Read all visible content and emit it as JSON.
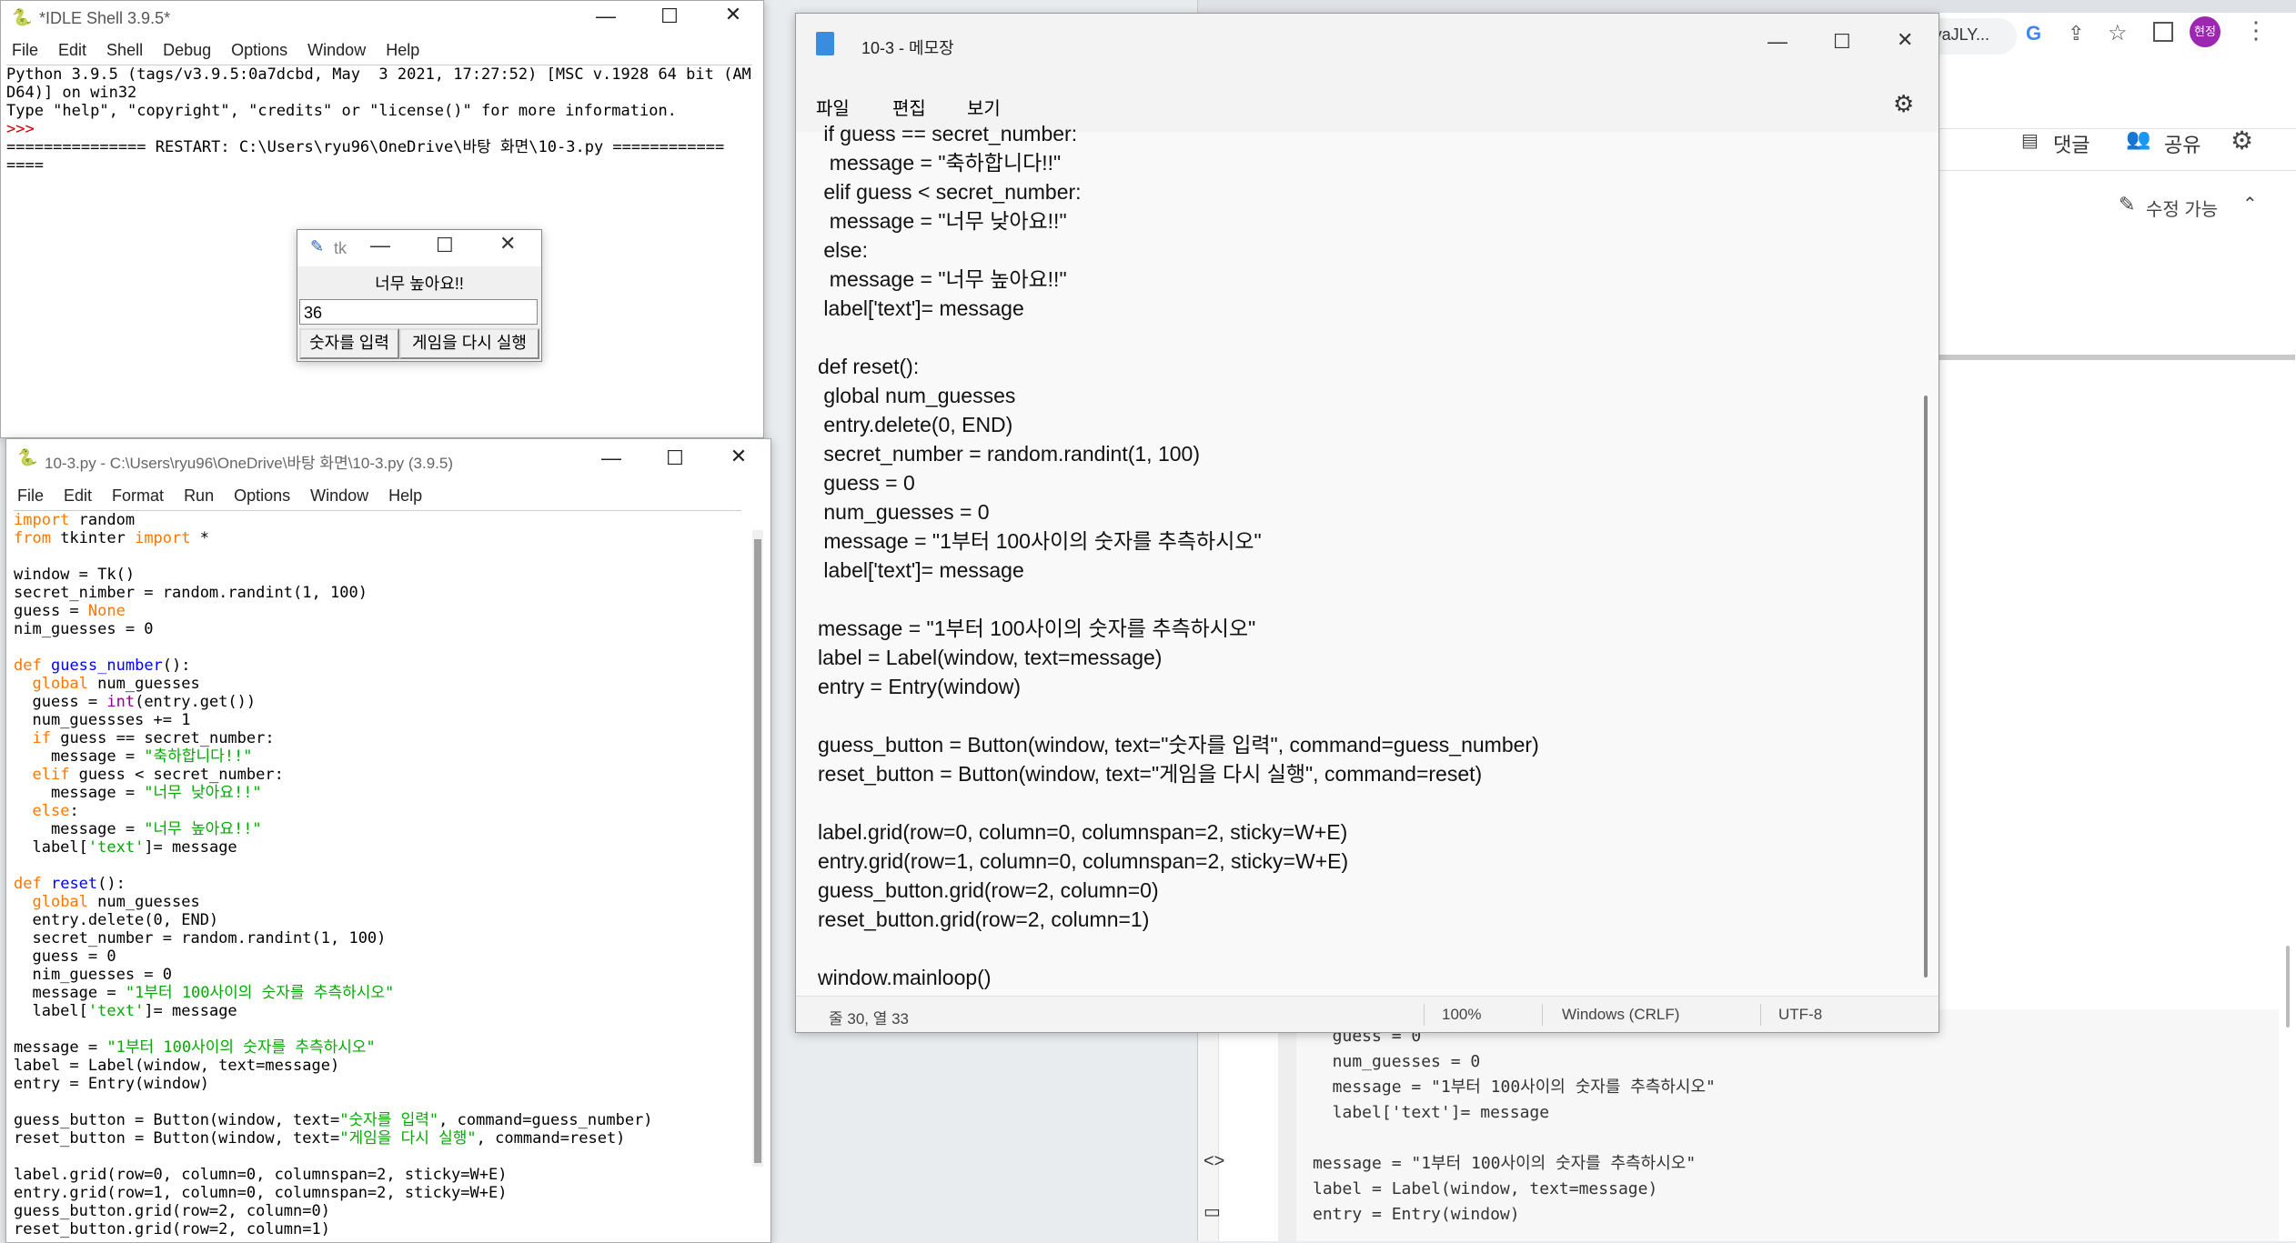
{
  "desktop": {
    "bg": "#e9ecef"
  },
  "idle_shell": {
    "title": "*IDLE Shell 3.9.5*",
    "menu": [
      "File",
      "Edit",
      "Shell",
      "Debug",
      "Options",
      "Window",
      "Help"
    ],
    "lines": [
      "Python 3.9.5 (tags/v3.9.5:0a7dcbd, May  3 2021, 17:27:52) [MSC v.1928 64 bit (AM",
      "D64)] on win32",
      "Type \"help\", \"copyright\", \"credits\" or \"license()\" for more information.",
      ">>> ",
      "=============== RESTART: C:\\Users\\ryu96\\OneDrive\\바탕 화면\\10-3.py ============",
      "===="
    ]
  },
  "tk_window": {
    "title": "tk",
    "label": "너무 높아요!!",
    "entry_value": "36",
    "guess_button": "숫자를 입력",
    "reset_button": "게임을 다시 실행"
  },
  "idle_editor": {
    "title": "10-3.py - C:\\Users\\ryu96\\OneDrive\\바탕 화면\\10-3.py (3.9.5)",
    "menu": [
      "File",
      "Edit",
      "Format",
      "Run",
      "Options",
      "Window",
      "Help"
    ]
  },
  "notepad": {
    "title": "10-3 - 메모장",
    "menu": [
      "파일",
      "편집",
      "보기"
    ],
    "status": {
      "position": "줄 30, 열 33",
      "zoom": "100%",
      "line_ending": "Windows (CRLF)",
      "encoding": "UTF-8"
    },
    "lines": [
      " if guess == secret_number:",
      "  message = \"축하합니다!!\"",
      " elif guess < secret_number:",
      "  message = \"너무 낮아요!!\"",
      " else:",
      "  message = \"너무 높아요!!\"",
      " label['text']= message",
      "",
      "def reset():",
      " global num_guesses",
      " entry.delete(0, END)",
      " secret_number = random.randint(1, 100)",
      " guess = 0",
      " num_guesses = 0",
      " message = \"1부터 100사이의 숫자를 추측하시오\"",
      " label['text']= message",
      "",
      "message = \"1부터 100사이의 숫자를 추측하시오\"",
      "label = Label(window, text=message)",
      "entry = Entry(window)",
      "",
      "guess_button = Button(window, text=\"숫자를 입력\", command=guess_number)",
      "reset_button = Button(window, text=\"게임을 다시 실행\", command=reset)",
      "",
      "label.grid(row=0, column=0, columnspan=2, sticky=W+E)",
      "entry.grid(row=1, column=0, columnspan=2, sticky=W+E)",
      "guess_button.grid(row=2, column=0)",
      "reset_button.grid(row=2, column=1)",
      "",
      "window.mainloop()"
    ]
  },
  "chrome": {
    "url_fragment": "ryaJLY...",
    "profile": "현정",
    "comment_label": "댓글",
    "share_label": "공유",
    "edit_label": "수정 가능",
    "code_lines": [
      "  guess = 0",
      "  num_guesses = 0",
      "  message = \"1부터 100사이의 숫자를 추측하시오\"",
      "  label['text']= message",
      "",
      "message = \"1부터 100사이의 숫자를 추측하시오\"",
      "label = Label(window, text=message)",
      "entry = Entry(window)"
    ]
  }
}
